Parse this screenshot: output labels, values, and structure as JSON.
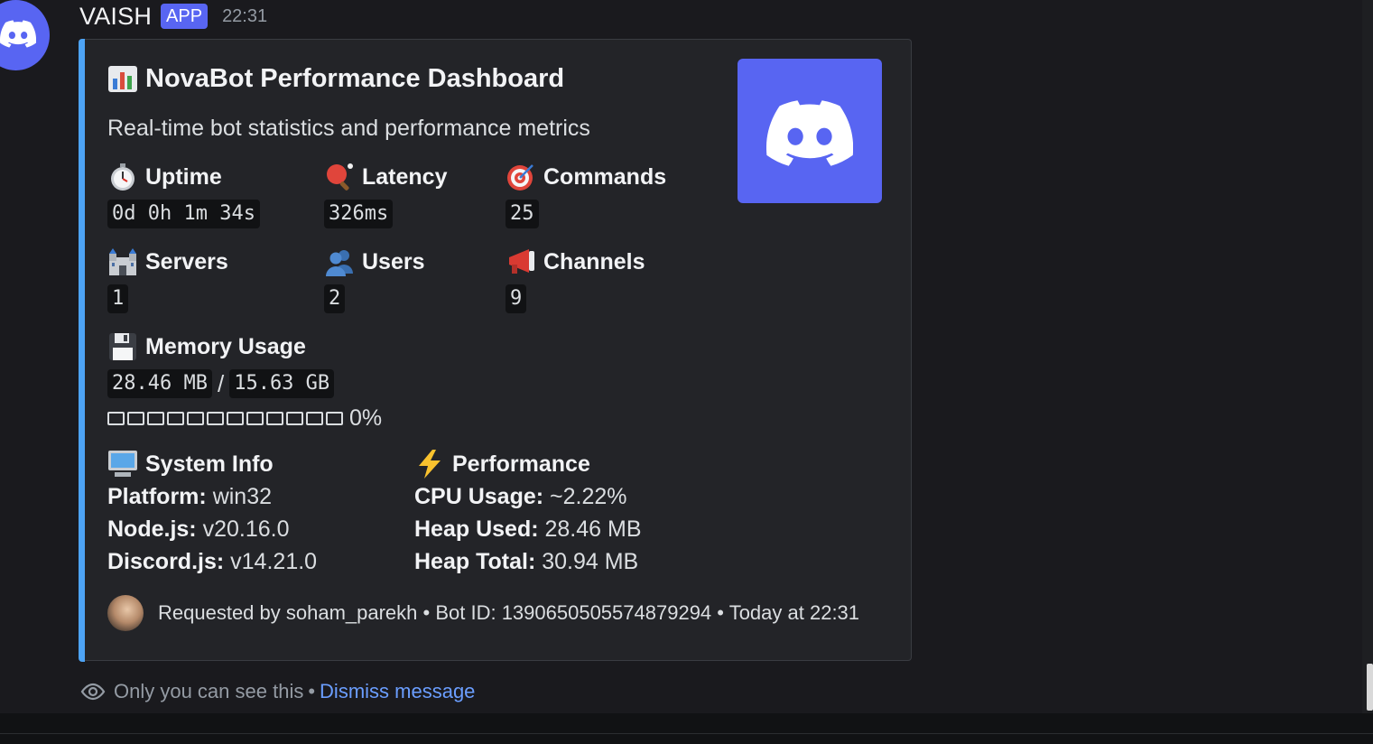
{
  "message": {
    "username": "VAISH",
    "app_badge": "APP",
    "timestamp": "22:31"
  },
  "embed": {
    "accent_color": "#4da3f5",
    "title": "NovaBot Performance Dashboard",
    "title_icon": "bar-chart-icon",
    "description": "Real-time bot statistics and performance metrics",
    "thumbnail_icon": "discord-logo-icon",
    "stats": [
      {
        "label": "Uptime",
        "icon": "stopwatch-icon",
        "value": "0d 0h 1m 34s"
      },
      {
        "label": "Latency",
        "icon": "ping-pong-icon",
        "value": "326ms"
      },
      {
        "label": "Commands",
        "icon": "direct-hit-icon",
        "value": "25"
      },
      {
        "label": "Servers",
        "icon": "castle-icon",
        "value": "1"
      },
      {
        "label": "Users",
        "icon": "busts-icon",
        "value": "2"
      },
      {
        "label": "Channels",
        "icon": "megaphone-icon",
        "value": "9"
      }
    ],
    "memory": {
      "label": "Memory Usage",
      "icon": "floppy-disk-icon",
      "used": "28.46 MB",
      "separator": "/",
      "total": "15.63 GB",
      "percent_text": "0%",
      "fill_fraction": 0
    },
    "system_info": {
      "label": "System Info",
      "icon": "computer-icon",
      "rows": [
        {
          "key": "Platform:",
          "value": "win32"
        },
        {
          "key": "Node.js:",
          "value": "v20.16.0"
        },
        {
          "key": "Discord.js:",
          "value": "v14.21.0"
        }
      ]
    },
    "performance": {
      "label": "Performance",
      "icon": "lightning-icon",
      "rows": [
        {
          "key": "CPU Usage:",
          "value": "~2.22%"
        },
        {
          "key": "Heap Used:",
          "value": "28.46 MB"
        },
        {
          "key": "Heap Total:",
          "value": "30.94 MB"
        }
      ]
    },
    "footer": {
      "text": "Requested by soham_parekh • Bot ID: 1390650505574879294 • Today at 22:31"
    }
  },
  "ephemeral": {
    "notice": "Only you can see this",
    "separator": "•",
    "dismiss_label": "Dismiss message"
  },
  "colors": {
    "background": "#1a1a1e",
    "embed_background": "#232428",
    "blurple": "#5865f2",
    "link": "#6b9eff"
  }
}
